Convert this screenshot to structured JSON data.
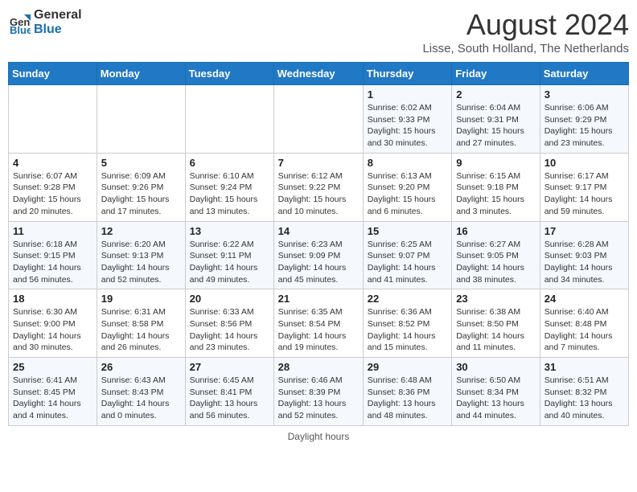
{
  "header": {
    "logo_line1": "General",
    "logo_line2": "Blue",
    "month_title": "August 2024",
    "location": "Lisse, South Holland, The Netherlands"
  },
  "weekdays": [
    "Sunday",
    "Monday",
    "Tuesday",
    "Wednesday",
    "Thursday",
    "Friday",
    "Saturday"
  ],
  "footer": {
    "daylight_label": "Daylight hours"
  },
  "weeks": [
    [
      {
        "day": "",
        "info": ""
      },
      {
        "day": "",
        "info": ""
      },
      {
        "day": "",
        "info": ""
      },
      {
        "day": "",
        "info": ""
      },
      {
        "day": "1",
        "info": "Sunrise: 6:02 AM\nSunset: 9:33 PM\nDaylight: 15 hours\nand 30 minutes."
      },
      {
        "day": "2",
        "info": "Sunrise: 6:04 AM\nSunset: 9:31 PM\nDaylight: 15 hours\nand 27 minutes."
      },
      {
        "day": "3",
        "info": "Sunrise: 6:06 AM\nSunset: 9:29 PM\nDaylight: 15 hours\nand 23 minutes."
      }
    ],
    [
      {
        "day": "4",
        "info": "Sunrise: 6:07 AM\nSunset: 9:28 PM\nDaylight: 15 hours\nand 20 minutes."
      },
      {
        "day": "5",
        "info": "Sunrise: 6:09 AM\nSunset: 9:26 PM\nDaylight: 15 hours\nand 17 minutes."
      },
      {
        "day": "6",
        "info": "Sunrise: 6:10 AM\nSunset: 9:24 PM\nDaylight: 15 hours\nand 13 minutes."
      },
      {
        "day": "7",
        "info": "Sunrise: 6:12 AM\nSunset: 9:22 PM\nDaylight: 15 hours\nand 10 minutes."
      },
      {
        "day": "8",
        "info": "Sunrise: 6:13 AM\nSunset: 9:20 PM\nDaylight: 15 hours\nand 6 minutes."
      },
      {
        "day": "9",
        "info": "Sunrise: 6:15 AM\nSunset: 9:18 PM\nDaylight: 15 hours\nand 3 minutes."
      },
      {
        "day": "10",
        "info": "Sunrise: 6:17 AM\nSunset: 9:17 PM\nDaylight: 14 hours\nand 59 minutes."
      }
    ],
    [
      {
        "day": "11",
        "info": "Sunrise: 6:18 AM\nSunset: 9:15 PM\nDaylight: 14 hours\nand 56 minutes."
      },
      {
        "day": "12",
        "info": "Sunrise: 6:20 AM\nSunset: 9:13 PM\nDaylight: 14 hours\nand 52 minutes."
      },
      {
        "day": "13",
        "info": "Sunrise: 6:22 AM\nSunset: 9:11 PM\nDaylight: 14 hours\nand 49 minutes."
      },
      {
        "day": "14",
        "info": "Sunrise: 6:23 AM\nSunset: 9:09 PM\nDaylight: 14 hours\nand 45 minutes."
      },
      {
        "day": "15",
        "info": "Sunrise: 6:25 AM\nSunset: 9:07 PM\nDaylight: 14 hours\nand 41 minutes."
      },
      {
        "day": "16",
        "info": "Sunrise: 6:27 AM\nSunset: 9:05 PM\nDaylight: 14 hours\nand 38 minutes."
      },
      {
        "day": "17",
        "info": "Sunrise: 6:28 AM\nSunset: 9:03 PM\nDaylight: 14 hours\nand 34 minutes."
      }
    ],
    [
      {
        "day": "18",
        "info": "Sunrise: 6:30 AM\nSunset: 9:00 PM\nDaylight: 14 hours\nand 30 minutes."
      },
      {
        "day": "19",
        "info": "Sunrise: 6:31 AM\nSunset: 8:58 PM\nDaylight: 14 hours\nand 26 minutes."
      },
      {
        "day": "20",
        "info": "Sunrise: 6:33 AM\nSunset: 8:56 PM\nDaylight: 14 hours\nand 23 minutes."
      },
      {
        "day": "21",
        "info": "Sunrise: 6:35 AM\nSunset: 8:54 PM\nDaylight: 14 hours\nand 19 minutes."
      },
      {
        "day": "22",
        "info": "Sunrise: 6:36 AM\nSunset: 8:52 PM\nDaylight: 14 hours\nand 15 minutes."
      },
      {
        "day": "23",
        "info": "Sunrise: 6:38 AM\nSunset: 8:50 PM\nDaylight: 14 hours\nand 11 minutes."
      },
      {
        "day": "24",
        "info": "Sunrise: 6:40 AM\nSunset: 8:48 PM\nDaylight: 14 hours\nand 7 minutes."
      }
    ],
    [
      {
        "day": "25",
        "info": "Sunrise: 6:41 AM\nSunset: 8:45 PM\nDaylight: 14 hours\nand 4 minutes."
      },
      {
        "day": "26",
        "info": "Sunrise: 6:43 AM\nSunset: 8:43 PM\nDaylight: 14 hours\nand 0 minutes."
      },
      {
        "day": "27",
        "info": "Sunrise: 6:45 AM\nSunset: 8:41 PM\nDaylight: 13 hours\nand 56 minutes."
      },
      {
        "day": "28",
        "info": "Sunrise: 6:46 AM\nSunset: 8:39 PM\nDaylight: 13 hours\nand 52 minutes."
      },
      {
        "day": "29",
        "info": "Sunrise: 6:48 AM\nSunset: 8:36 PM\nDaylight: 13 hours\nand 48 minutes."
      },
      {
        "day": "30",
        "info": "Sunrise: 6:50 AM\nSunset: 8:34 PM\nDaylight: 13 hours\nand 44 minutes."
      },
      {
        "day": "31",
        "info": "Sunrise: 6:51 AM\nSunset: 8:32 PM\nDaylight: 13 hours\nand 40 minutes."
      }
    ]
  ]
}
